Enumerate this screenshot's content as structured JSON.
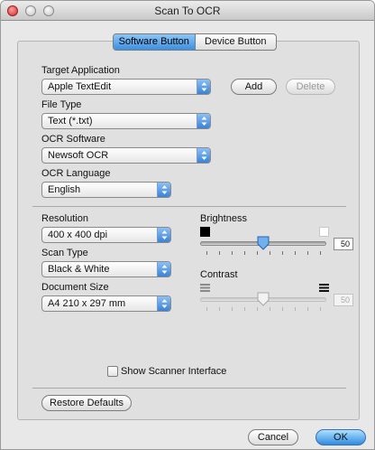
{
  "window": {
    "title": "Scan To OCR"
  },
  "tabs": [
    {
      "label": "Software Button",
      "active": true
    },
    {
      "label": "Device Button",
      "active": false
    }
  ],
  "target_application": {
    "label": "Target Application",
    "value": "Apple TextEdit",
    "add_label": "Add",
    "delete_label": "Delete"
  },
  "file_type": {
    "label": "File Type",
    "value": "Text (*.txt)"
  },
  "ocr_software": {
    "label": "OCR Software",
    "value": "Newsoft OCR"
  },
  "ocr_language": {
    "label": "OCR Language",
    "value": "English"
  },
  "resolution": {
    "label": "Resolution",
    "value": "400 x 400 dpi"
  },
  "scan_type": {
    "label": "Scan Type",
    "value": "Black & White"
  },
  "document_size": {
    "label": "Document Size",
    "value": "A4  210 x 297 mm"
  },
  "brightness": {
    "label": "Brightness",
    "value": "50",
    "level": 0.5,
    "enabled": true
  },
  "contrast": {
    "label": "Contrast",
    "value": "50",
    "level": 0.5,
    "enabled": false
  },
  "show_scanner_interface": {
    "label": "Show Scanner Interface",
    "checked": false
  },
  "footer": {
    "restore_label": "Restore Defaults",
    "cancel_label": "Cancel",
    "ok_label": "OK"
  },
  "colors": {
    "accent": "#3c8fe0",
    "window_bg": "#e8e8e8",
    "panel_bg": "#e0e0e0"
  }
}
